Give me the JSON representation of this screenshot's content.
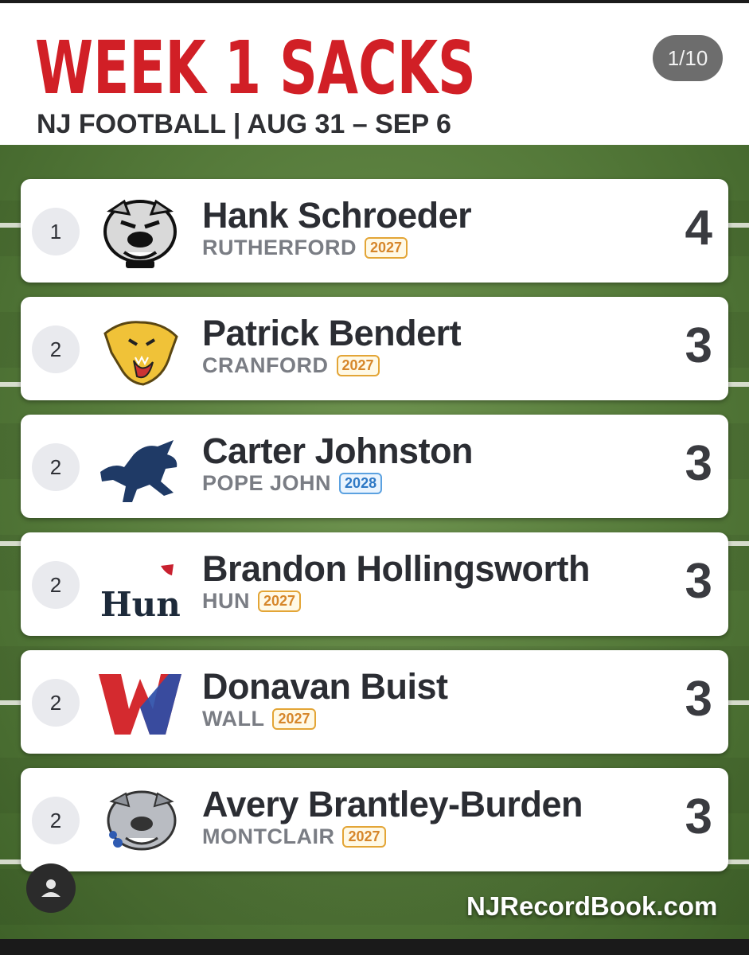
{
  "header": {
    "title": "WEEK 1 SACKS",
    "subtitle": "NJ FOOTBALL | AUG 31 – SEP 6",
    "pager": "1/10"
  },
  "rows": [
    {
      "rank": "1",
      "name": "Hank Schroeder",
      "school": "RUTHERFORD",
      "year": "2027",
      "sacks": "4",
      "logo": "bulldog-logo"
    },
    {
      "rank": "2",
      "name": "Patrick Bendert",
      "school": "CRANFORD",
      "year": "2027",
      "sacks": "3",
      "logo": "cougar-logo"
    },
    {
      "rank": "2",
      "name": "Carter Johnston",
      "school": "POPE JOHN",
      "year": "2028",
      "sacks": "3",
      "logo": "lion-logo"
    },
    {
      "rank": "2",
      "name": "Brandon Hollingsworth",
      "school": "HUN",
      "year": "2027",
      "sacks": "3",
      "logo": "hun-logo",
      "logo_text": "Hun"
    },
    {
      "rank": "2",
      "name": "Donavan Buist",
      "school": "WALL",
      "year": "2027",
      "sacks": "3",
      "logo": "w-logo",
      "logo_text": "W"
    },
    {
      "rank": "2",
      "name": "Avery Brantley-Burden",
      "school": "MONTCLAIR",
      "year": "2027",
      "sacks": "3",
      "logo": "bulldog-logo"
    }
  ],
  "footer": {
    "site": "NJRecordBook.com",
    "avatar_icon": "person-icon"
  },
  "colors": {
    "title_red": "#d11f26",
    "year_orange": "#e3a536",
    "year_blue": "#5ba1e0",
    "field_green": "#557a3a"
  }
}
